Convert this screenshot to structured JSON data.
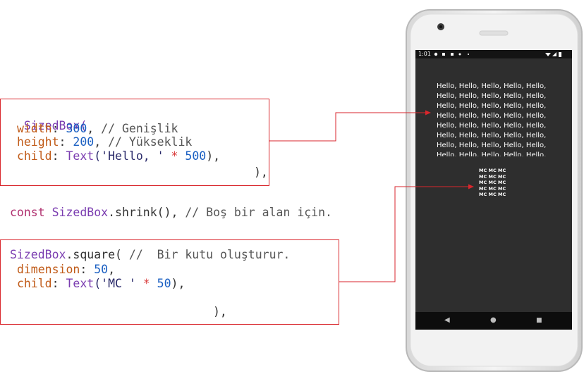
{
  "code1": {
    "line1": {
      "a": "SizedBox("
    },
    "line2": {
      "param": "width",
      "sep": ": ",
      "num": "300",
      "comma": ", ",
      "cmt": "// Genişlik"
    },
    "line3": {
      "param": "height",
      "sep": ": ",
      "num": "200",
      "comma": ", ",
      "cmt": "// Yükseklik"
    },
    "line4": {
      "param": "child",
      "sep": ": ",
      "cls": "Text",
      "str": "('Hello, '",
      "op": " * ",
      "num": "500",
      "end": "),"
    },
    "line5": {
      "a": "),"
    }
  },
  "code2": {
    "kw": "const ",
    "cls": "SizedBox",
    "rest": ".shrink(), ",
    "cmt": "// Boş bir alan için."
  },
  "code3": {
    "line1": {
      "cls": "SizedBox",
      "rest": ".square( ",
      "cmt": "//  Bir kutu oluşturur."
    },
    "line2": {
      "param": "dimension",
      "sep": ": ",
      "num": "50",
      "comma": ","
    },
    "line3": {
      "param": "child",
      "sep": ": ",
      "cls": "Text",
      "str": "('MC '",
      "op": " * ",
      "num": "50",
      "end": "),"
    },
    "line4": {
      "a": "),"
    }
  },
  "phone": {
    "status_time": "1:01",
    "hello_line": "Hello, Hello, Hello, Hello, Hello,",
    "mc_line": "MC MC MC",
    "nav_back": "◀",
    "nav_home": "●",
    "nav_recent": "■"
  },
  "colors": {
    "arrow": "#d9262c",
    "screen": "#2e2e2e",
    "nav_bar": "#0d0d0d"
  }
}
